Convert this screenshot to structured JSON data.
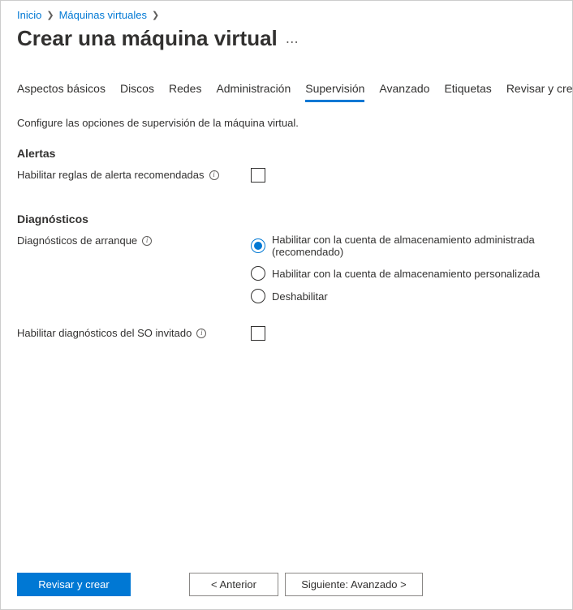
{
  "breadcrumb": {
    "home": "Inicio",
    "vms": "Máquinas virtuales"
  },
  "page": {
    "title": "Crear una máquina virtual"
  },
  "tabs": [
    {
      "label": "Aspectos básicos"
    },
    {
      "label": "Discos"
    },
    {
      "label": "Redes"
    },
    {
      "label": "Administración"
    },
    {
      "label": "Supervisión",
      "active": true
    },
    {
      "label": "Avanzado"
    },
    {
      "label": "Etiquetas"
    },
    {
      "label": "Revisar y crear"
    }
  ],
  "intro": "Configure las opciones de supervisión de la máquina virtual.",
  "sections": {
    "alerts": {
      "heading": "Alertas",
      "recommended_rules_label": "Habilitar reglas de alerta recomendadas",
      "recommended_rules_checked": false
    },
    "diagnostics": {
      "heading": "Diagnósticos",
      "boot_label": "Diagnósticos de arranque",
      "boot_options": [
        {
          "label": "Habilitar con la cuenta de almacenamiento administrada (recomendado)",
          "selected": true
        },
        {
          "label": "Habilitar con la cuenta de almacenamiento personalizada",
          "selected": false
        },
        {
          "label": "Deshabilitar",
          "selected": false
        }
      ],
      "guest_label": "Habilitar diagnósticos del SO invitado",
      "guest_checked": false
    }
  },
  "footer": {
    "review": "Revisar y crear",
    "prev": "<  Anterior",
    "next": "Siguiente: Avanzado  >"
  }
}
